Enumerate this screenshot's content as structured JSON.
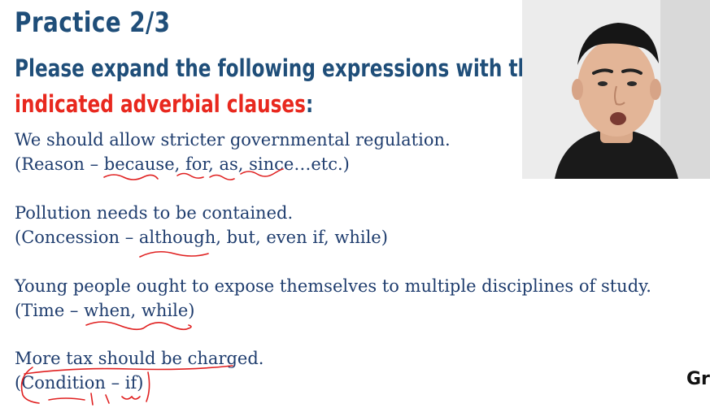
{
  "slide": {
    "title": "Practice 2/3",
    "instruction_line1": "Please expand the following expressions with the",
    "instruction_highlight": "indicated adverbial clauses",
    "instruction_suffix": ":"
  },
  "exercises": [
    {
      "sentence": "We should allow stricter governmental regulation.",
      "hint": "(Reason – because, for, as, since…etc.)"
    },
    {
      "sentence": "Pollution needs to be contained.",
      "hint": "(Concession – although, but, even if, while)"
    },
    {
      "sentence": "Young people ought to expose themselves to multiple disciplines of study.",
      "hint": "(Time – when, while)"
    },
    {
      "sentence": "More tax should be charged.",
      "hint": "(Condition – if)"
    }
  ],
  "brand_text": "Gr",
  "colors": {
    "heading": "#1f4e79",
    "highlight": "#e8281e",
    "body_text": "#1f3d6e",
    "annotation": "#e02020"
  }
}
